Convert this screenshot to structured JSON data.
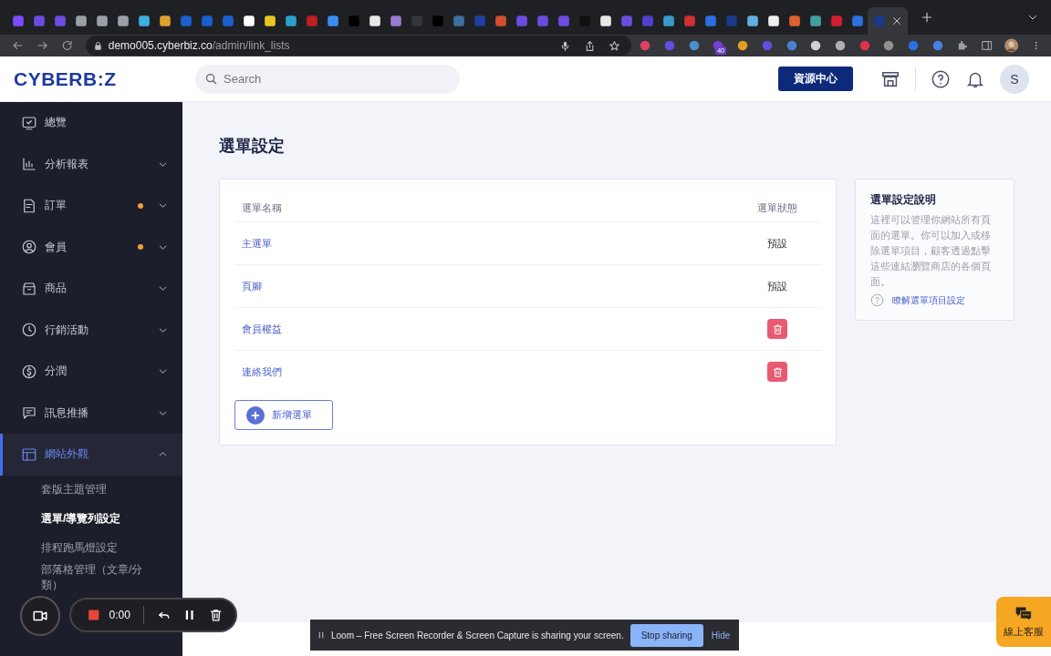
{
  "browser": {
    "tabs": [
      {
        "color": "#7b4dff",
        "selected": false
      },
      {
        "color": "#6a4ce0",
        "selected": false
      },
      {
        "color": "#6a4ce0",
        "selected": false
      },
      {
        "color": "#9aa0a6",
        "selected": false
      },
      {
        "color": "#9aa0a6",
        "selected": false
      },
      {
        "color": "#9aa0a6",
        "selected": false
      },
      {
        "color": "#3ab0e0",
        "selected": false
      },
      {
        "color": "#e0a030",
        "selected": false
      },
      {
        "color": "#1a5fd0",
        "selected": false
      },
      {
        "color": "#1a5fd0",
        "selected": false
      },
      {
        "color": "#1a5fd0",
        "selected": false
      },
      {
        "color": "#ffffff",
        "selected": false
      },
      {
        "color": "#e8c820",
        "selected": false
      },
      {
        "color": "#2a9fd0",
        "selected": false
      },
      {
        "color": "#c02020",
        "selected": false
      },
      {
        "color": "#3a8ef0",
        "selected": false
      },
      {
        "color": "#000000",
        "selected": false
      },
      {
        "color": "#e8e8e8",
        "selected": false
      },
      {
        "color": "#9a7ad0",
        "selected": false
      },
      {
        "color": "#35363a",
        "selected": false
      },
      {
        "color": "#000000",
        "selected": false
      },
      {
        "color": "#3a6fa0",
        "selected": false
      },
      {
        "color": "#2040a0",
        "selected": false
      },
      {
        "color": "#d05030",
        "selected": false
      },
      {
        "color": "#6a4ce0",
        "selected": false
      },
      {
        "color": "#6a4ce0",
        "selected": false
      },
      {
        "color": "#6a4ce0",
        "selected": false
      },
      {
        "color": "#101010",
        "selected": false
      },
      {
        "color": "#e8e8e8",
        "selected": false
      },
      {
        "color": "#6a4ce0",
        "selected": false
      },
      {
        "color": "#5040d0",
        "selected": false
      },
      {
        "color": "#3a9ad0",
        "selected": false
      },
      {
        "color": "#d03030",
        "selected": false
      },
      {
        "color": "#2a70e0",
        "selected": false
      },
      {
        "color": "#1a3a8a",
        "selected": false
      },
      {
        "color": "#60b0e0",
        "selected": false
      },
      {
        "color": "#f0f0f0",
        "selected": false
      },
      {
        "color": "#e06030",
        "selected": false
      },
      {
        "color": "#40a0a0",
        "selected": false
      },
      {
        "color": "#d02030",
        "selected": false
      },
      {
        "color": "#2a70e0",
        "selected": false
      },
      {
        "color": "#1a3a8a",
        "selected": true
      }
    ],
    "address": {
      "host": "demo005.cyberbiz.co",
      "path": "/admin/link_lists"
    },
    "extensions": [
      {
        "color": "#e04060"
      },
      {
        "color": "#6050e0"
      },
      {
        "color": "#4a90d0"
      },
      {
        "color": "#7040d0",
        "badge": "40"
      },
      {
        "color": "#e0a020"
      },
      {
        "color": "#6050e0"
      },
      {
        "color": "#4a80d0"
      },
      {
        "color": "#d0d0d0"
      },
      {
        "color": "#b0b0b0"
      },
      {
        "color": "#e03050"
      },
      {
        "color": "#909090"
      },
      {
        "color": "#2a70e0"
      },
      {
        "color": "#4a80e0"
      }
    ]
  },
  "header": {
    "logo": "CYBERB:Z",
    "search": {
      "placeholder": "Search"
    },
    "resource_button": "資源中心",
    "avatar": "S"
  },
  "sidebar": {
    "items": [
      {
        "label": "總覽",
        "dot": false,
        "expandable": false,
        "selected": false
      },
      {
        "label": "分析報表",
        "dot": false,
        "expandable": true,
        "expanded": false,
        "selected": false
      },
      {
        "label": "訂單",
        "dot": true,
        "expandable": true,
        "expanded": false,
        "selected": false
      },
      {
        "label": "會員",
        "dot": true,
        "expandable": true,
        "expanded": false,
        "selected": false
      },
      {
        "label": "商品",
        "dot": false,
        "expandable": true,
        "expanded": false,
        "selected": false
      },
      {
        "label": "行銷活動",
        "dot": false,
        "expandable": true,
        "expanded": false,
        "selected": false
      },
      {
        "label": "分潤",
        "dot": false,
        "expandable": true,
        "expanded": false,
        "selected": false
      },
      {
        "label": "訊息推播",
        "dot": false,
        "expandable": true,
        "expanded": false,
        "selected": false
      },
      {
        "label": "網站外觀",
        "dot": false,
        "expandable": true,
        "expanded": true,
        "selected": true,
        "children": [
          {
            "label": "套版主題管理",
            "selected": false
          },
          {
            "label": "選單/導覽列設定",
            "selected": true
          },
          {
            "label": "排程跑馬燈設定",
            "selected": false
          },
          {
            "label": "部落格管理（文章/分類）",
            "selected": false
          }
        ]
      }
    ]
  },
  "page": {
    "title": "選單設定",
    "table": {
      "columns": [
        "選單名稱",
        "選單狀態"
      ],
      "rows": [
        {
          "name": "主選單",
          "kind": "default",
          "status": "預設"
        },
        {
          "name": "頁腳",
          "kind": "default",
          "status": "預設"
        },
        {
          "name": "會員權益",
          "kind": "delete"
        },
        {
          "name": "連絡我們",
          "kind": "delete"
        }
      ]
    },
    "add_button": "新增選單",
    "help": {
      "title": "選單設定說明",
      "body": "這裡可以管理你網站所有頁面的選單。你可以加入或移除選單項目，顧客透過點擊這些連結瀏覽商店的各個頁面。",
      "link": "瞭解選單項目設定"
    }
  },
  "recorder": {
    "timer": "0:00"
  },
  "share_banner": {
    "text": "Loom – Free Screen Recorder & Screen Capture is sharing your screen.",
    "stop_button": "Stop sharing",
    "hide_button": "Hide"
  },
  "chat_button": "線上客服"
}
